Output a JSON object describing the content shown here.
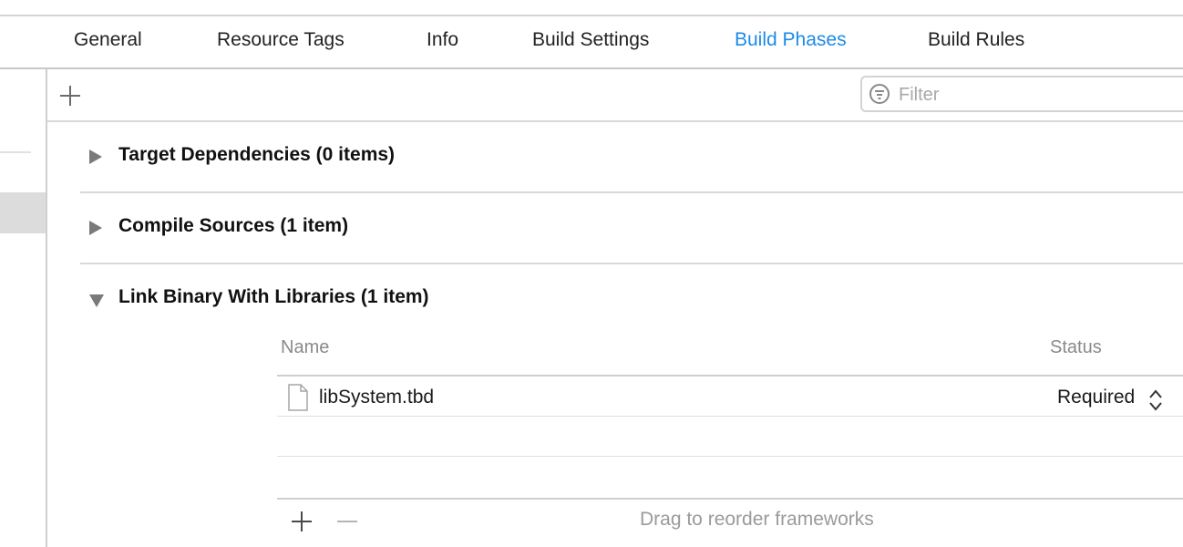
{
  "tabs": [
    {
      "label": "General"
    },
    {
      "label": "Resource Tags"
    },
    {
      "label": "Info"
    },
    {
      "label": "Build Settings"
    },
    {
      "label": "Build Phases",
      "active": true
    },
    {
      "label": "Build Rules"
    }
  ],
  "toolbar": {
    "add_icon": "plus-icon",
    "filter_icon": "filter-icon",
    "filter_placeholder": "Filter",
    "filter_value": ""
  },
  "phases": [
    {
      "title": "Target Dependencies (0 items)",
      "expanded": false
    },
    {
      "title": "Compile Sources (1 item)",
      "expanded": false
    },
    {
      "title": "Link Binary With Libraries (1 item)",
      "expanded": true
    }
  ],
  "link_table": {
    "columns": [
      "Name",
      "Status"
    ],
    "rows": [
      {
        "name": "libSystem.tbd",
        "status": "Required",
        "icon": "file-icon"
      }
    ],
    "footer_hint": "Drag to reorder frameworks"
  },
  "colors": {
    "accent": "#1d8ae6",
    "separator": "#d9d9d9",
    "disclosure": "#7a7a7a",
    "muted_text": "#8a8a8a"
  }
}
